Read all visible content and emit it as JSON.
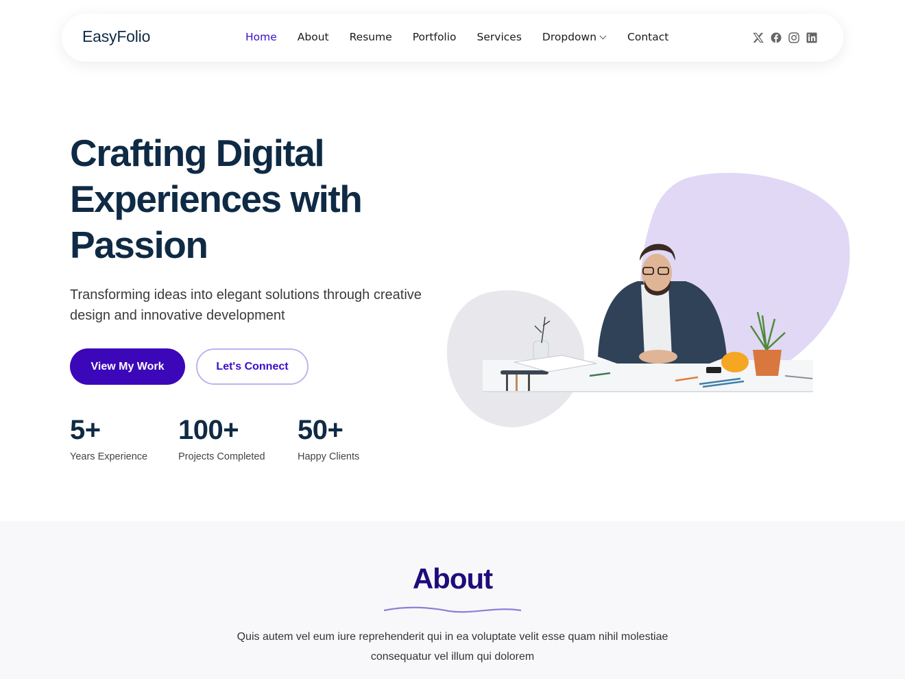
{
  "header": {
    "logo": "EasyFolio",
    "nav": [
      {
        "label": "Home",
        "active": true
      },
      {
        "label": "About"
      },
      {
        "label": "Resume"
      },
      {
        "label": "Portfolio"
      },
      {
        "label": "Services"
      },
      {
        "label": "Dropdown",
        "has_dropdown": true
      },
      {
        "label": "Contact"
      }
    ],
    "socials": [
      "x-twitter",
      "facebook",
      "instagram",
      "linkedin"
    ]
  },
  "hero": {
    "title_lines": [
      "Crafting Digital",
      "Experiences with",
      "Passion"
    ],
    "subtitle": "Transforming ideas into elegant solutions through creative design and innovative development",
    "primary_button": "View My Work",
    "secondary_button": "Let's Connect",
    "stats": [
      {
        "value": "5+",
        "label": "Years Experience"
      },
      {
        "value": "100+",
        "label": "Projects Completed"
      },
      {
        "value": "50+",
        "label": "Happy Clients"
      }
    ],
    "image_alt": "Designer sketching at a desk"
  },
  "about": {
    "title": "About",
    "text": "Quis autem vel eum iure reprehenderit qui in ea voluptate velit esse quam nihil molestiae consequatur vel illum qui dolorem"
  },
  "colors": {
    "accent": "#3b07b8",
    "heading": "#0f2a44",
    "blob_purple": "#e0d8f5",
    "blob_gray": "#e8e8ec"
  }
}
